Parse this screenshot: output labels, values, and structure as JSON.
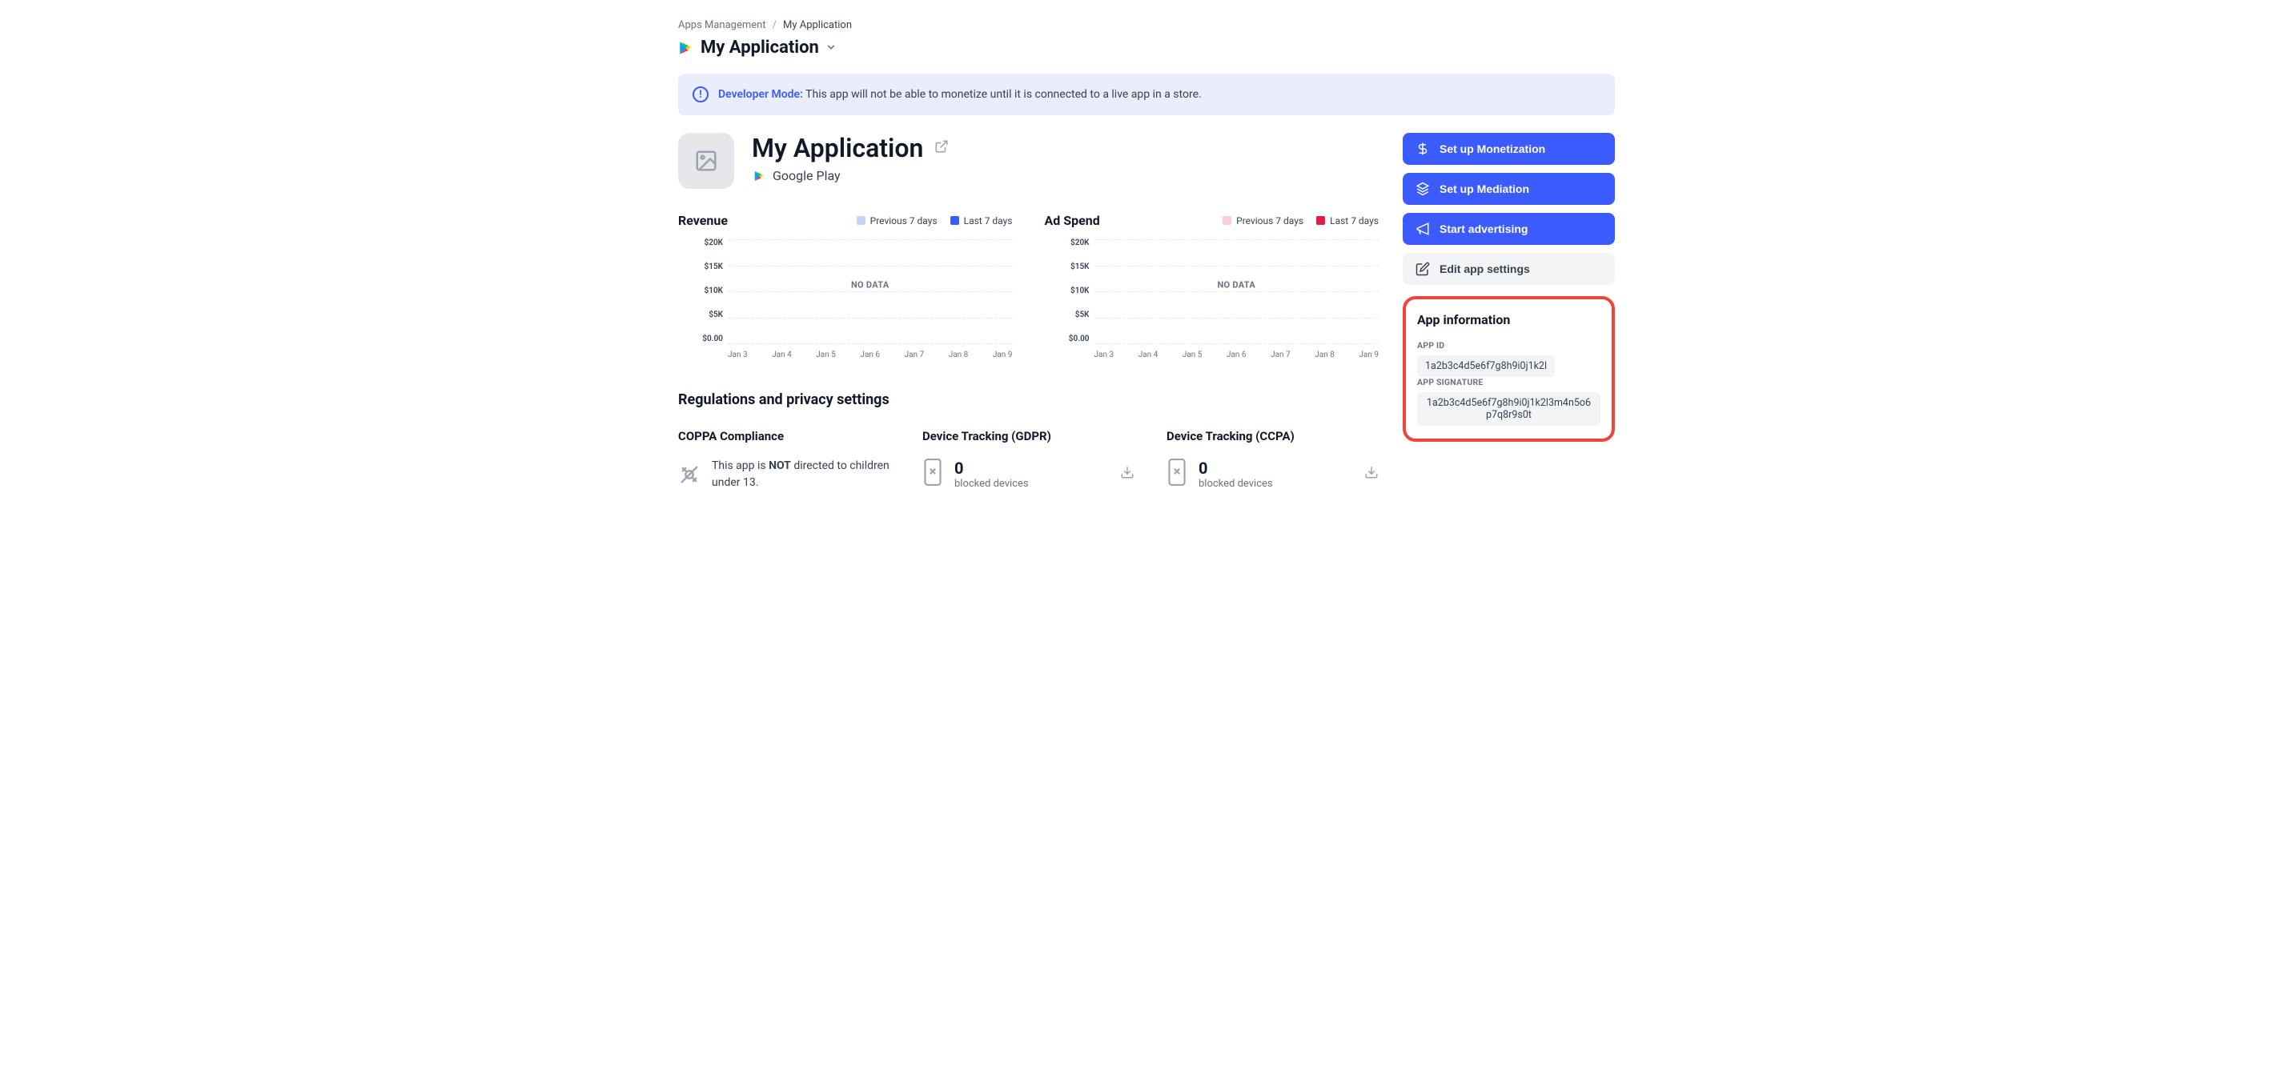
{
  "breadcrumb": {
    "parent": "Apps Management",
    "current": "My Application"
  },
  "app_switcher": {
    "title": "My Application"
  },
  "alert": {
    "label": "Developer Mode:",
    "text": "This app will not be able to monetize until it is connected to a live app in a store."
  },
  "app_header": {
    "title": "My Application",
    "store": "Google Play"
  },
  "side_actions": {
    "monetization": "Set up Monetization",
    "mediation": "Set up Mediation",
    "advertising": "Start advertising",
    "settings": "Edit app settings"
  },
  "app_info": {
    "title": "App information",
    "id_label": "APP ID",
    "id_value": "1a2b3c4d5e6f7g8h9i0j1k2l",
    "sig_label": "APP SIGNATURE",
    "sig_value": "1a2b3c4d5e6f7g8h9i0j1k2l3m4n5o6p7q8r9s0t"
  },
  "charts": {
    "revenue": {
      "title": "Revenue",
      "legend_prev": "Previous 7 days",
      "legend_curr": "Last 7 days",
      "swatch_prev": "#c7d2fe",
      "swatch_curr": "#3b5bfd",
      "no_data": "NO DATA"
    },
    "adspend": {
      "title": "Ad Spend",
      "legend_prev": "Previous 7 days",
      "legend_curr": "Last 7 days",
      "swatch_prev": "#fecdd3",
      "swatch_curr": "#e11d48",
      "no_data": "NO DATA"
    },
    "yticks": [
      "$20K",
      "$15K",
      "$10K",
      "$5K",
      "$0.00"
    ],
    "xticks": [
      "Jan 3",
      "Jan 4",
      "Jan 5",
      "Jan 6",
      "Jan 7",
      "Jan 8",
      "Jan 9"
    ]
  },
  "regulations": {
    "title": "Regulations and privacy settings",
    "coppa": {
      "title": "COPPA Compliance",
      "text_pre": "This app is ",
      "text_strong": "NOT",
      "text_post": " directed to children under 13."
    },
    "gdpr": {
      "title": "Device Tracking (GDPR)",
      "count": "0",
      "sub": "blocked devices"
    },
    "ccpa": {
      "title": "Device Tracking (CCPA)",
      "count": "0",
      "sub": "blocked devices"
    }
  },
  "chart_data": [
    {
      "type": "bar",
      "title": "Revenue",
      "categories": [
        "Jan 3",
        "Jan 4",
        "Jan 5",
        "Jan 6",
        "Jan 7",
        "Jan 8",
        "Jan 9"
      ],
      "series": [
        {
          "name": "Previous 7 days",
          "values": [
            null,
            null,
            null,
            null,
            null,
            null,
            null
          ]
        },
        {
          "name": "Last 7 days",
          "values": [
            null,
            null,
            null,
            null,
            null,
            null,
            null
          ]
        }
      ],
      "ylabel": "USD",
      "ylim": [
        0,
        20000
      ],
      "note": "NO DATA"
    },
    {
      "type": "bar",
      "title": "Ad Spend",
      "categories": [
        "Jan 3",
        "Jan 4",
        "Jan 5",
        "Jan 6",
        "Jan 7",
        "Jan 8",
        "Jan 9"
      ],
      "series": [
        {
          "name": "Previous 7 days",
          "values": [
            null,
            null,
            null,
            null,
            null,
            null,
            null
          ]
        },
        {
          "name": "Last 7 days",
          "values": [
            null,
            null,
            null,
            null,
            null,
            null,
            null
          ]
        }
      ],
      "ylabel": "USD",
      "ylim": [
        0,
        20000
      ],
      "note": "NO DATA"
    }
  ]
}
